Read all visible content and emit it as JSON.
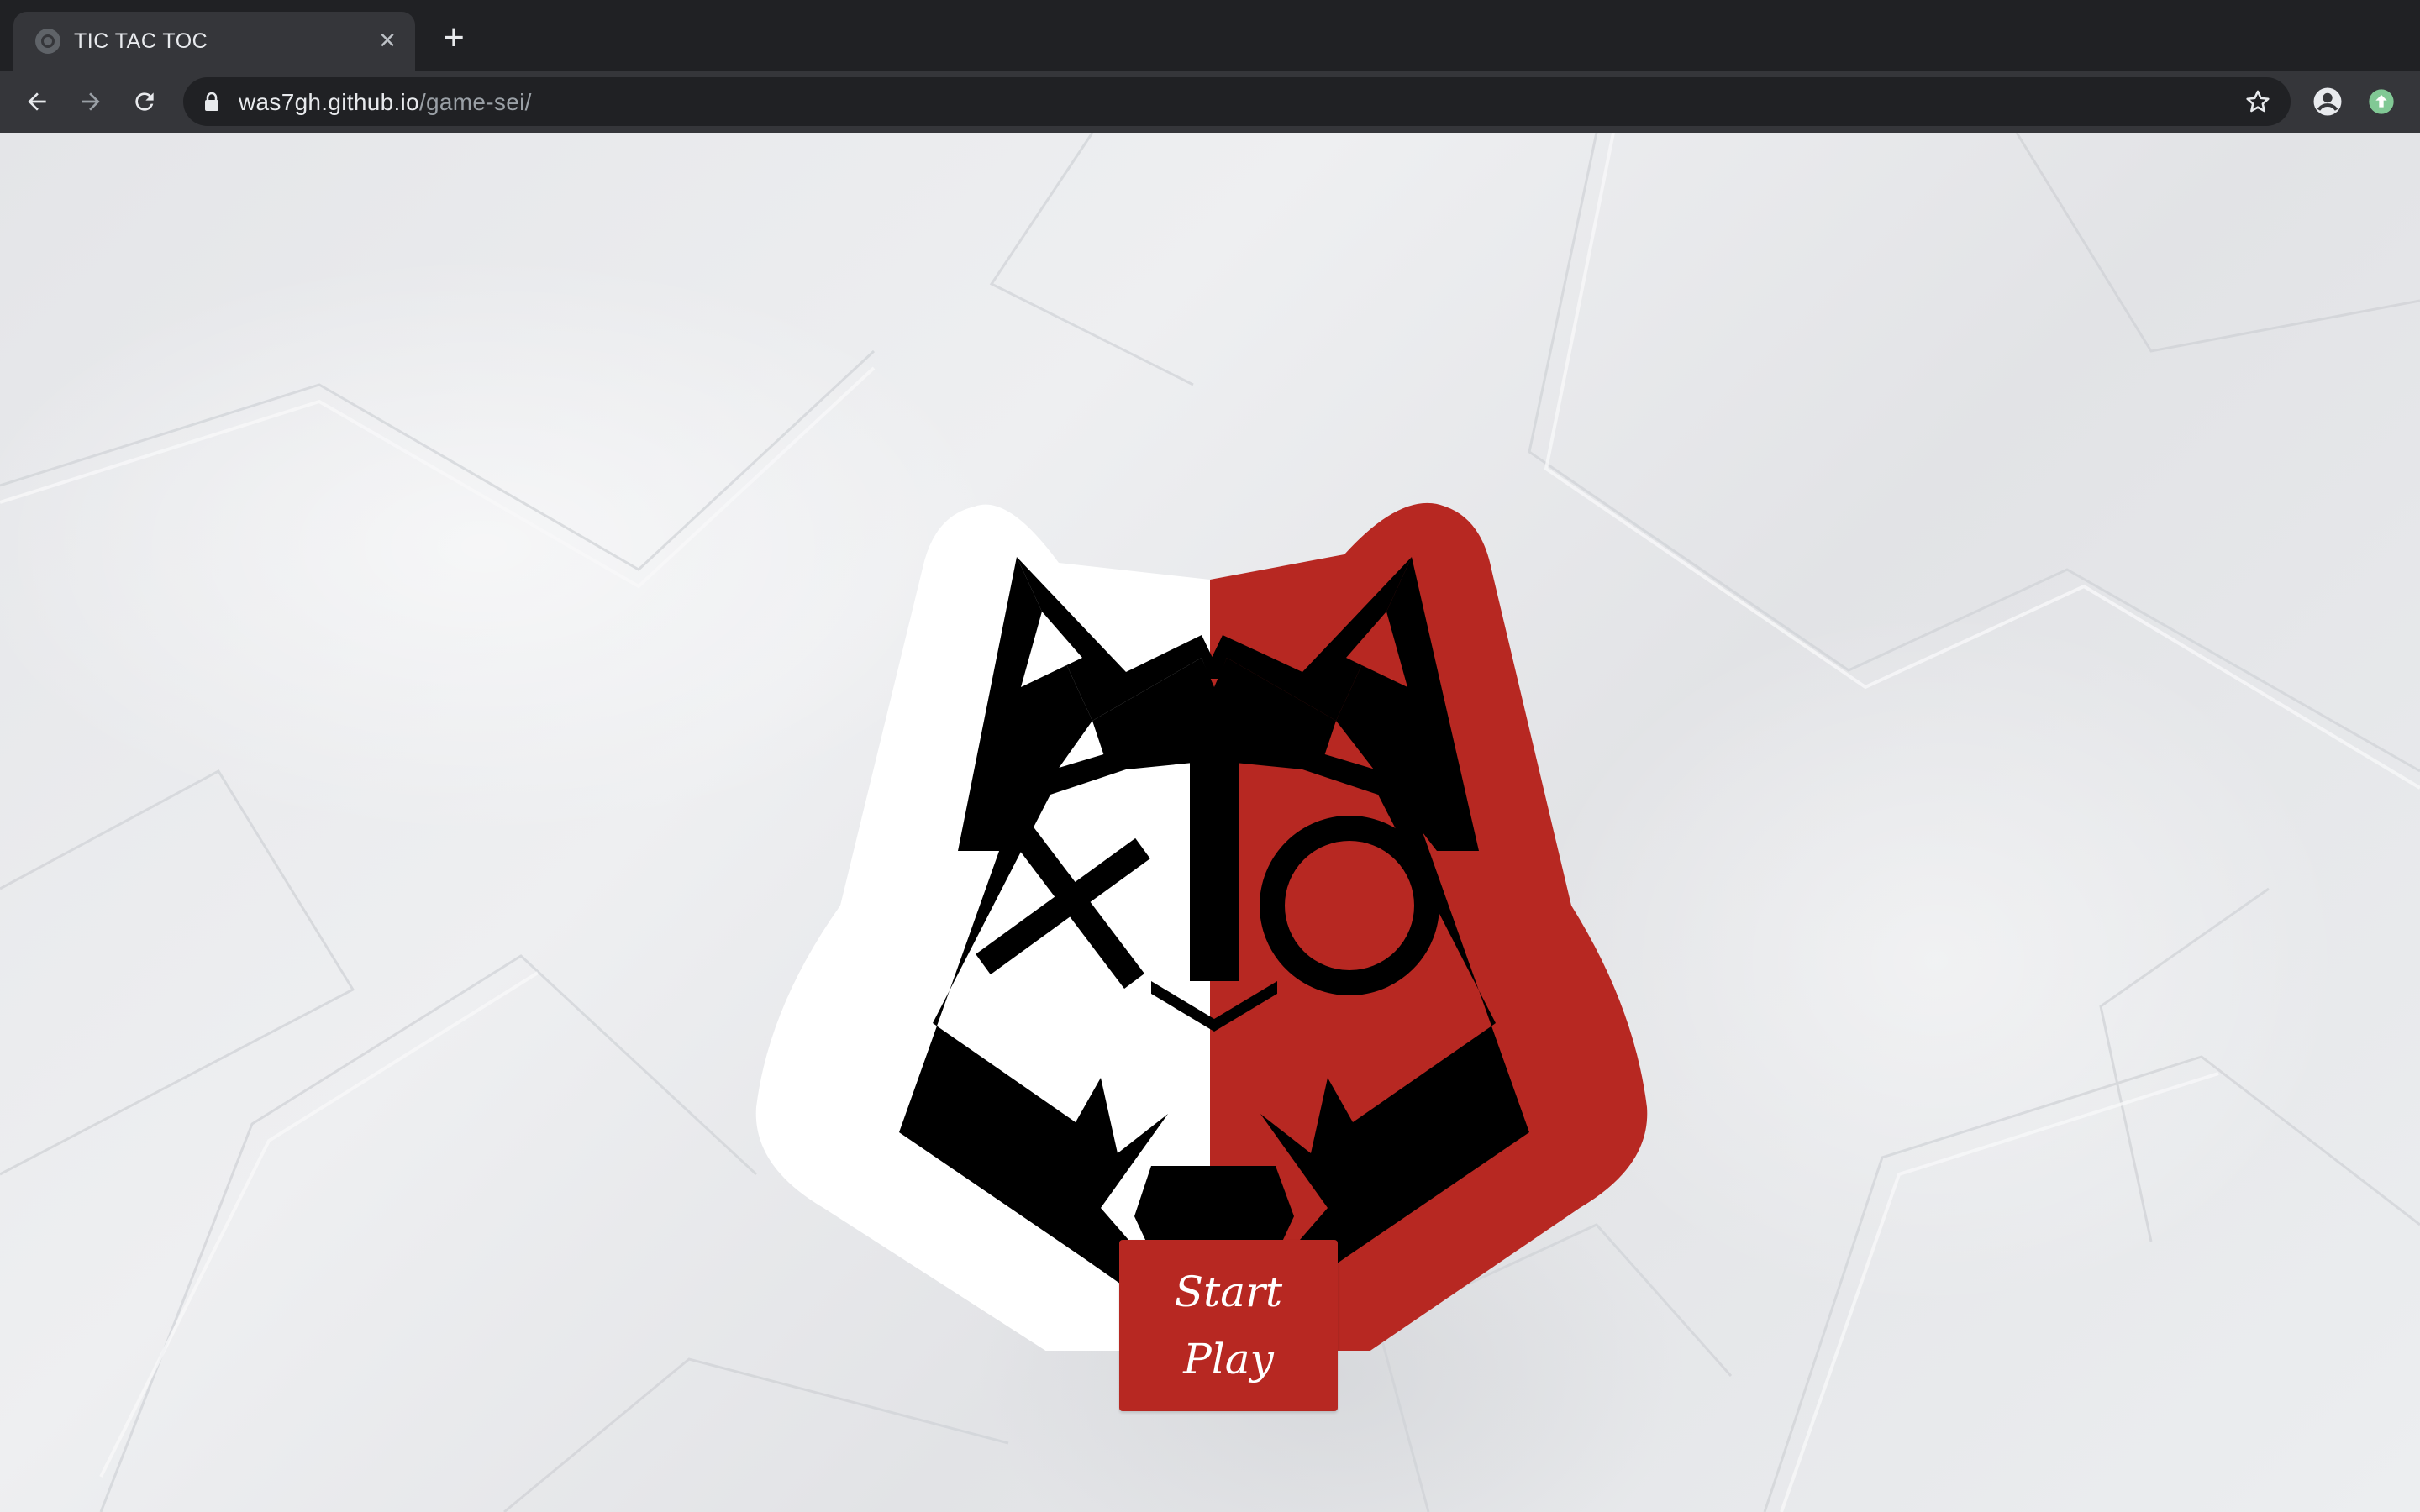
{
  "browser": {
    "tab_title": "TIC TAC TOC",
    "tab_close": "×",
    "new_tab": "+",
    "url_host": "was7gh.github.io",
    "url_path": "/game-sei/"
  },
  "page": {
    "start_button_line1": "Start",
    "start_button_line2": "Play",
    "colors": {
      "accent_red": "#b72822",
      "logo_black": "#000000",
      "logo_white": "#ffffff"
    }
  }
}
